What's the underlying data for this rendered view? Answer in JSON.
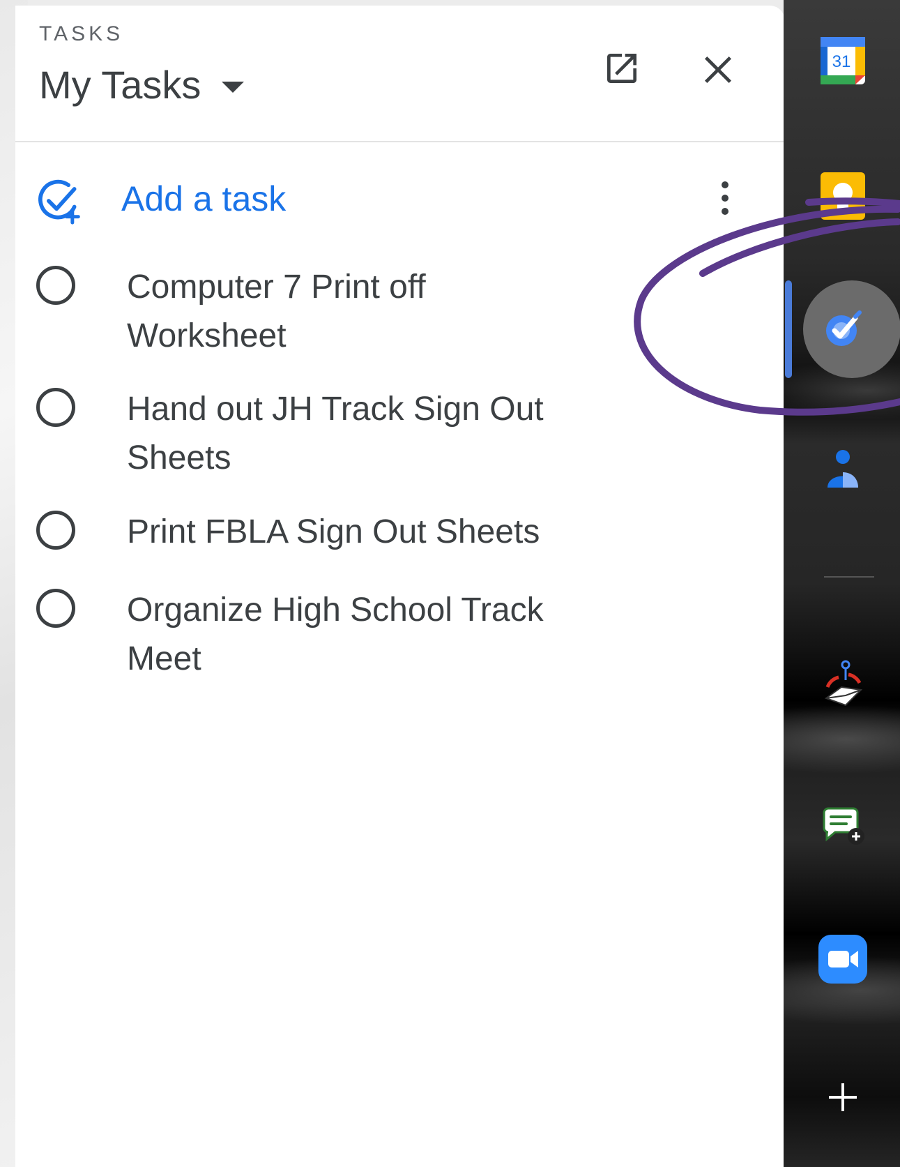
{
  "header": {
    "eyebrow": "TASKS",
    "list_name": "My Tasks"
  },
  "add_task": {
    "label": "Add a task"
  },
  "tasks": [
    {
      "text": "Computer 7 Print off Worksheet"
    },
    {
      "text": "Hand out JH Track Sign Out Sheets"
    },
    {
      "text": "Print FBLA Sign Out Sheets"
    },
    {
      "text": "Organize High School Track Meet"
    }
  ],
  "rail": {
    "calendar_day": "31",
    "active_app": "tasks"
  },
  "colors": {
    "accent": "#1a73e8",
    "annotation": "#5b3a8c"
  }
}
